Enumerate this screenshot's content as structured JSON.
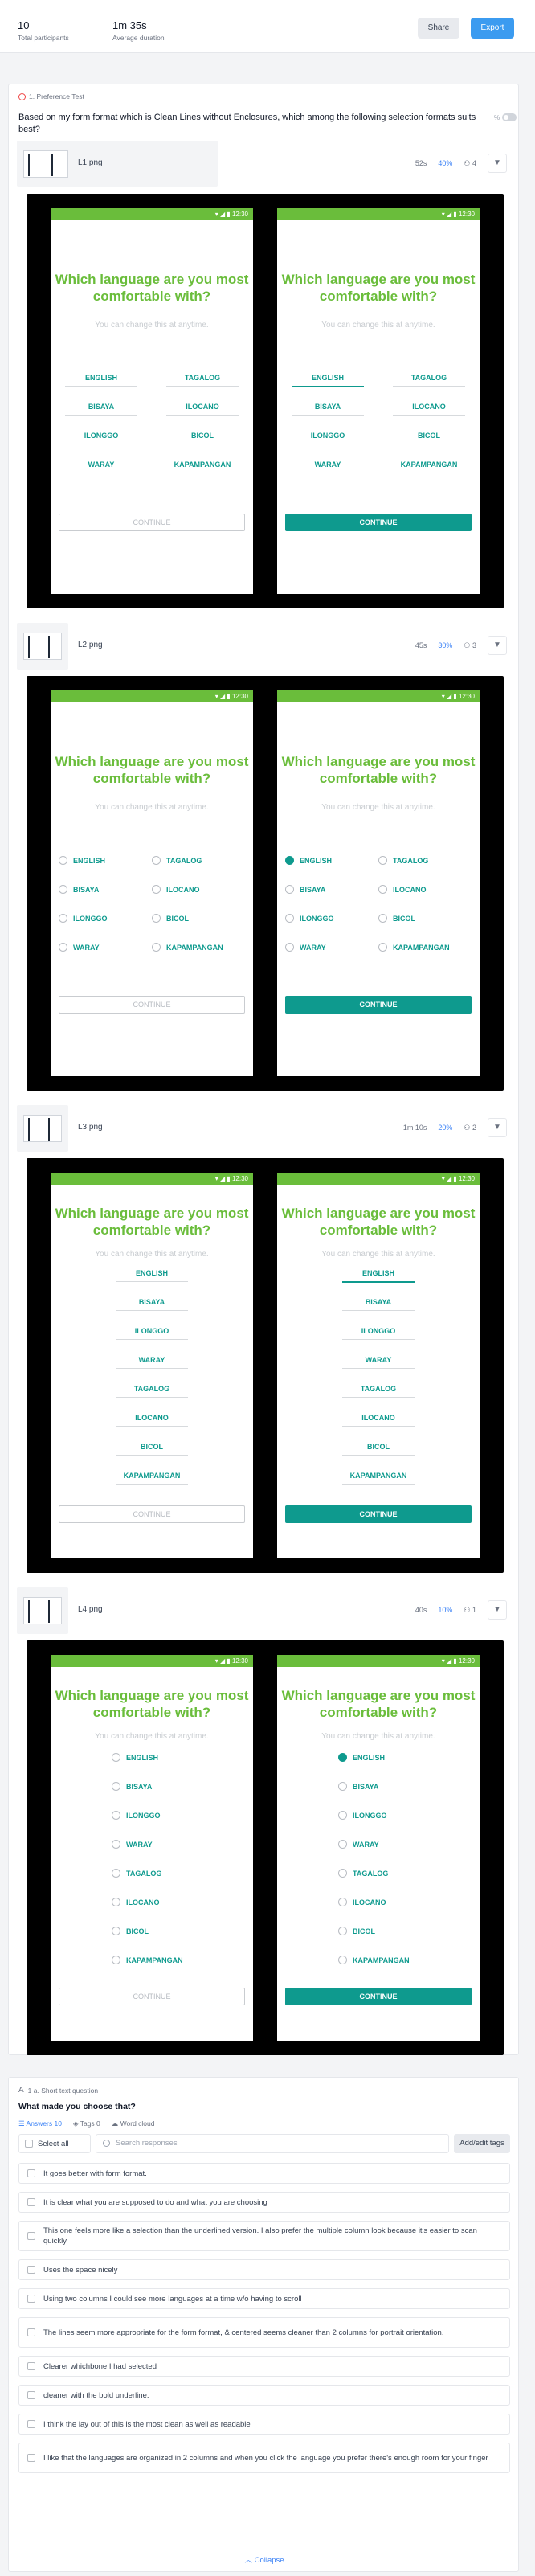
{
  "header": {
    "participants_value": "10",
    "participants_label": "Total participants",
    "duration_value": "1m 35s",
    "duration_label": "Average duration",
    "share_label": "Share",
    "export_label": "Export"
  },
  "question1": {
    "label": "1. Preference Test",
    "text": "Based on my form format which is Clean Lines without Enclosures, which among the following selection formats suits best?",
    "toggle_label": "%"
  },
  "screen": {
    "time": "12:30",
    "title": "Which language are you most comfortable with?",
    "subtitle": "You can change this at anytime.",
    "languages": [
      "ENGLISH",
      "TAGALOG",
      "BISAYA",
      "ILOCANO",
      "ILONGGO",
      "BICOL",
      "WARAY",
      "KAPAMPANGAN"
    ],
    "languages_list": [
      "ENGLISH",
      "BISAYA",
      "ILONGGO",
      "WARAY",
      "TAGALOG",
      "ILOCANO",
      "BICOL",
      "KAPAMPANGAN"
    ],
    "continue": "CONTINUE"
  },
  "options": [
    {
      "name": "L1.png",
      "time": "52s",
      "percent": "40%",
      "votes": "4"
    },
    {
      "name": "L2.png",
      "time": "45s",
      "percent": "30%",
      "votes": "3"
    },
    {
      "name": "L3.png",
      "time": "1m 10s",
      "percent": "20%",
      "votes": "2"
    },
    {
      "name": "L4.png",
      "time": "40s",
      "percent": "10%",
      "votes": "1"
    }
  ],
  "question1a": {
    "label": "1 a. Short text question",
    "text": "What made you choose that?",
    "tab_answers": "Answers 10",
    "tab_tags": "Tags 0",
    "tab_wordcloud": "Word cloud",
    "select_all": "Select all",
    "search_placeholder": "Search responses",
    "add_tags": "Add/edit tags",
    "responses": [
      "It goes better with form format.",
      "It is clear what you are supposed to do and what you are choosing",
      "This one feels more like a selection than the underlined version. I also prefer the multiple column look because it's easier to scan quickly",
      "Uses the space nicely",
      "Using two columns I could see more languages at a time w/o having to scroll",
      "The lines seem more appropriate for the form format, & centered seems cleaner than 2 columns for portrait orientation.",
      "Clearer whichbone I had selected",
      "cleaner with the bold underline.",
      "I think the lay out of this is the most clean as well as readable",
      "I like that the languages are organized in 2 columns and when you click the language you prefer there's enough room for your finger"
    ],
    "collapse": "Collapse"
  }
}
